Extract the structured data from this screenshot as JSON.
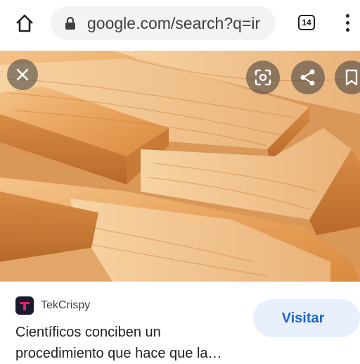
{
  "browser": {
    "url": "google.com/search?q=ir",
    "tab_count": "14",
    "icons": {
      "home": "home-icon",
      "lock": "lock-icon",
      "menu": "more-vert-icon"
    }
  },
  "viewer": {
    "image_alt": "wooden planks",
    "buttons": {
      "close": "close-icon",
      "lens": "google-lens-icon",
      "share": "share-icon",
      "save": "bookmark-icon"
    }
  },
  "result": {
    "source": "TekCrispy",
    "title": "Científicos conciben un procedimiento que hace que la…",
    "visit_label": "Visitar",
    "colors": {
      "accent": "#1967d2",
      "button_bg": "#e8f0fe",
      "favicon_accent": "#e91e63"
    }
  }
}
